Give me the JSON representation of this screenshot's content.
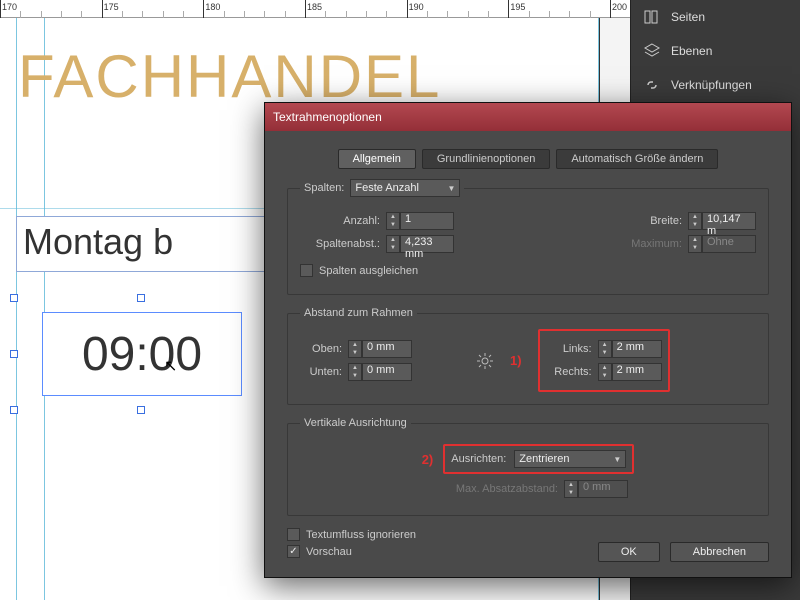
{
  "ruler": {
    "marks": [
      170,
      175,
      180,
      185,
      190,
      195,
      200
    ]
  },
  "canvas": {
    "headline": "FACHHANDEL",
    "line1": "Montag b",
    "line2": "09:00"
  },
  "panels": {
    "items": [
      {
        "label": "Seiten"
      },
      {
        "label": "Ebenen"
      },
      {
        "label": "Verknüpfungen"
      }
    ]
  },
  "dialog": {
    "title": "Textrahmenoptionen",
    "tabs": [
      "Allgemein",
      "Grundlinienoptionen",
      "Automatisch Größe ändern"
    ],
    "active_tab": 0,
    "spalten": {
      "legend": "Spalten:",
      "type": "Feste Anzahl",
      "anzahl_label": "Anzahl:",
      "anzahl": "1",
      "abst_label": "Spaltenabst.:",
      "abst": "4,233 mm",
      "breite_label": "Breite:",
      "breite": "10,147 m",
      "max_label": "Maximum:",
      "max": "Ohne",
      "ausgleichen": "Spalten ausgleichen"
    },
    "abstand": {
      "legend": "Abstand zum Rahmen",
      "oben_label": "Oben:",
      "oben": "0 mm",
      "unten_label": "Unten:",
      "unten": "0 mm",
      "links_label": "Links:",
      "links": "2 mm",
      "rechts_label": "Rechts:",
      "rechts": "2 mm",
      "marker": "1)"
    },
    "vert": {
      "legend": "Vertikale Ausrichtung",
      "ausrichten_label": "Ausrichten:",
      "ausrichten": "Zentrieren",
      "max_label": "Max. Absatzabstand:",
      "max": "0 mm",
      "marker": "2)"
    },
    "ignore": "Textumfluss ignorieren",
    "vorschau": "Vorschau",
    "ok": "OK",
    "cancel": "Abbrechen"
  }
}
